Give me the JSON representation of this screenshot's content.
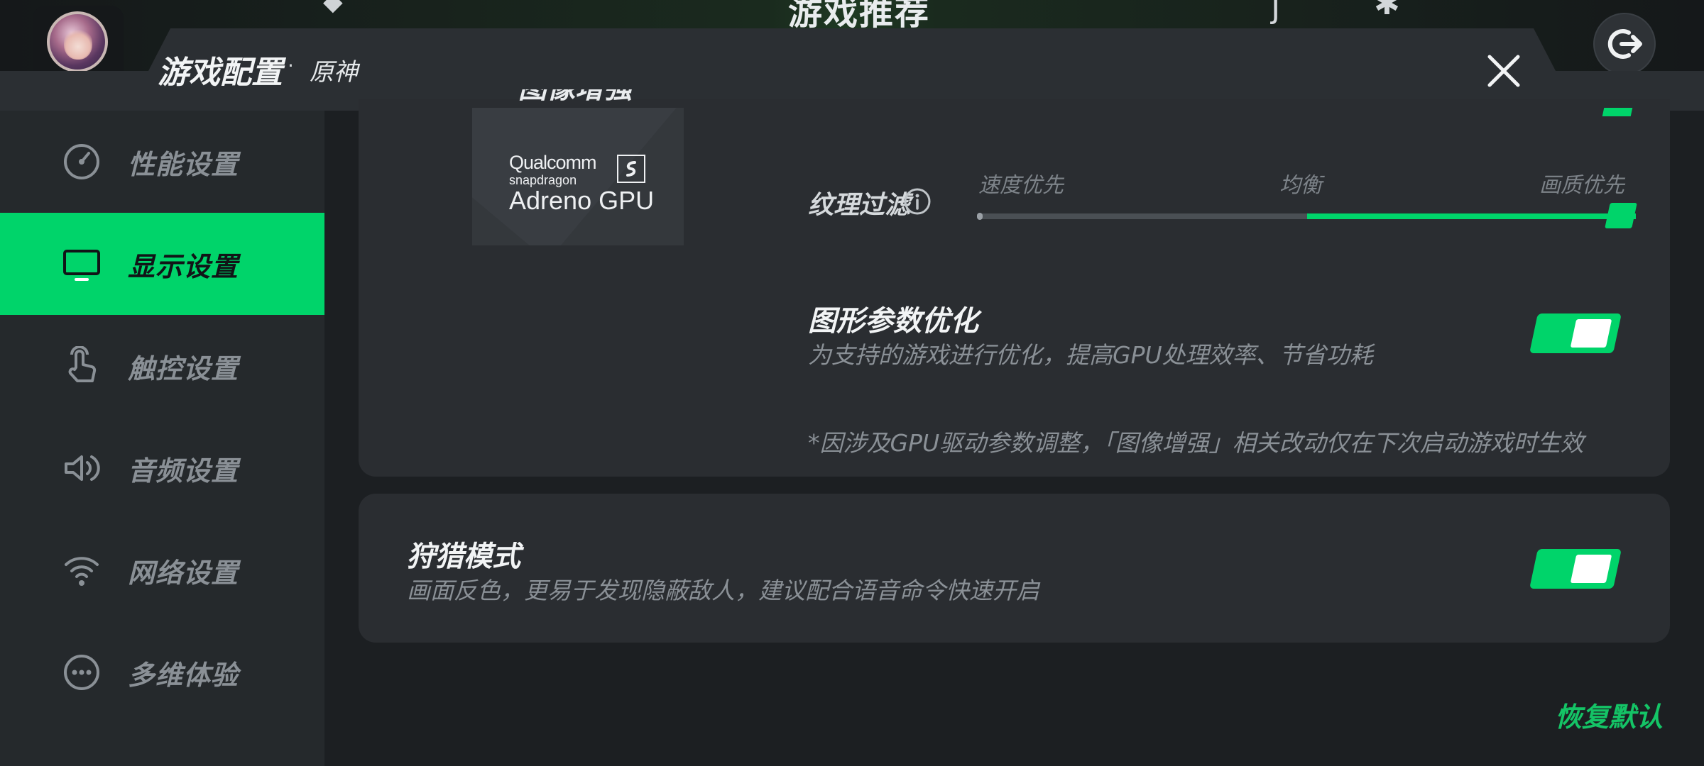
{
  "background": {
    "title": "游戏推荐"
  },
  "header": {
    "title": "游戏配置",
    "separator": "·",
    "subtitle": "原神"
  },
  "sidebar": {
    "items": [
      {
        "label": "性能设置",
        "icon": "gauge-icon",
        "active": false
      },
      {
        "label": "显示设置",
        "icon": "monitor-icon",
        "active": true
      },
      {
        "label": "触控设置",
        "icon": "touch-icon",
        "active": false
      },
      {
        "label": "音频设置",
        "icon": "speaker-icon",
        "active": false
      },
      {
        "label": "网络设置",
        "icon": "wifi-icon",
        "active": false
      },
      {
        "label": "多维体验",
        "icon": "more-icon",
        "active": false
      }
    ]
  },
  "image_enhance": {
    "heading": "图像增强",
    "gpu_brand": "Qualcomm",
    "gpu_sub": "snapdragon",
    "gpu_name": "Adreno GPU"
  },
  "texture_filter": {
    "label": "纹理过滤",
    "ticks": [
      "速度优先",
      "均衡",
      "画质优先"
    ],
    "value_fraction": 1.0
  },
  "graphics_opt": {
    "title": "图形参数优化",
    "desc": "为支持的游戏进行优化，提高GPU处理效率、节省功耗",
    "enabled": true
  },
  "note": "*因涉及GPU驱动参数调整，「图像增强」相关改动仅在下次启动游戏时生效",
  "hunting_mode": {
    "title": "狩猎模式",
    "desc": "画面反色，更易于发现隐蔽敌人，建议配合语音命令快速开启",
    "enabled": true
  },
  "footer": {
    "restore": "恢复默认"
  },
  "colors": {
    "accent": "#00d46a",
    "panel": "#2b2f33",
    "card": "#2a2d31"
  }
}
